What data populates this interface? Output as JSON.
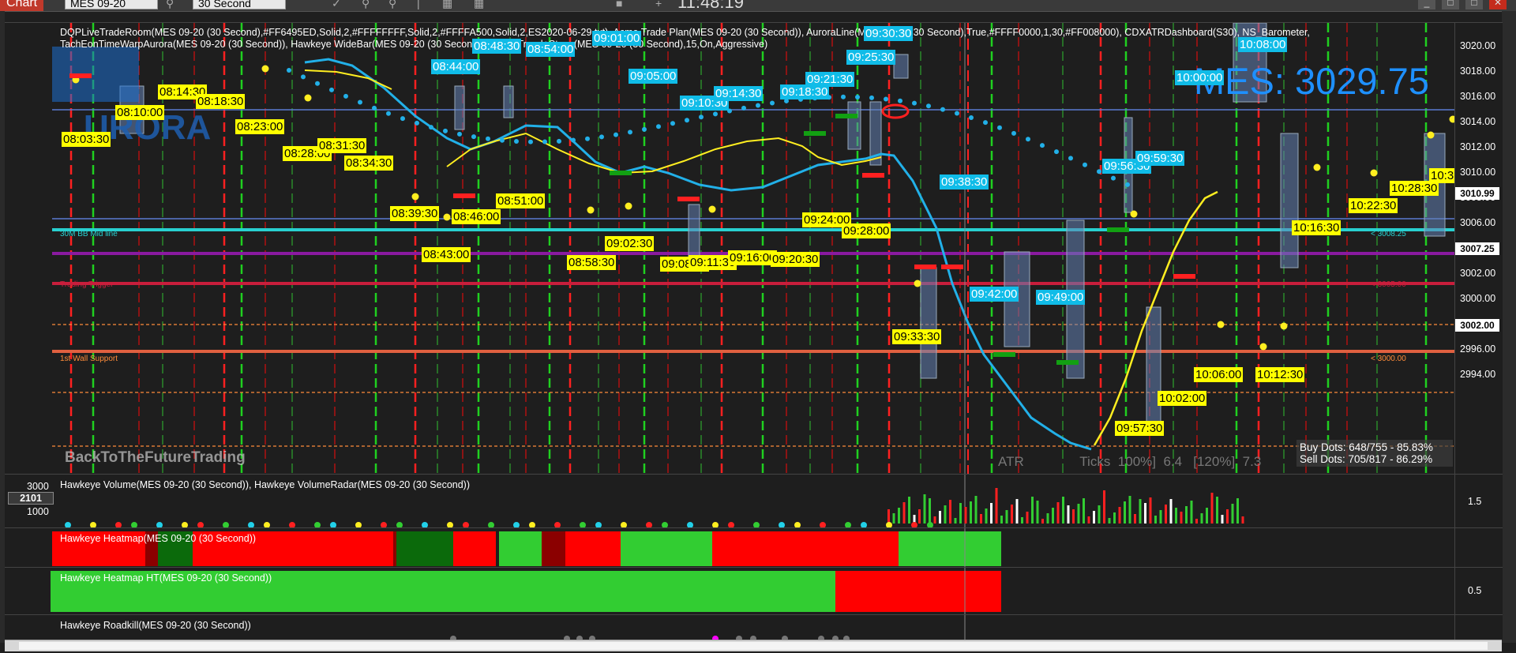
{
  "toolbar": {
    "chart_button": "Chart",
    "instrument": "MES 09-20",
    "interval": "30 Second",
    "clock": "11:48:19"
  },
  "main_panel": {
    "indicator_line_1": "DQPLiveTradeRoom(MES 09-20 (30 Second),#FF6495ED,Solid,2,#FFFFFFFF,Solid,2,#FFFFA500,Solid,2,ES2020-06-29.txt), Acme Trade Plan(MES 09-20 (30 Second)), AuroraLine(MES 09-20 (30 Second),True,#FFFF0000,1,30,#FF008000), CDXATRDashboard(S30), NS_Barometer,",
    "indicator_line_2": "TachEonTimeWarpAurora(MES 09-20 (30 Second)), Hawkeye WideBar(MES 09-20 (30 Second)), Wolfe Trend+Stops(MES 09-20 (30 Second),15,On,Aggressive)",
    "watermark_aurora": "URORA",
    "watermark_site": "BackToTheFutureTrading",
    "big_price": "MES: 3029.75",
    "buy_dots": "Buy Dots: 648/755 - 85.83%",
    "sell_dots": "Sell Dots: 705/817 - 86.29%",
    "atr_label": "ATR",
    "ticks_label": "Ticks",
    "pct100": "100%]",
    "pct100_val": "6.4",
    "pct120": "[120%]",
    "pct120_val": "7.3",
    "line_label_mid": "30M BB Mid line",
    "line_label_trigger": "Trading Trigger",
    "line_label_support": "1st Wall Support",
    "right_label_top": "< 3008.25",
    "right_label_mid": "< 3005.00",
    "right_label_low": "< 3000.00",
    "time_labels": [
      {
        "t": "08:44:00",
        "k": "c"
      },
      {
        "t": "08:48:30",
        "k": "c"
      },
      {
        "t": "08:54:00",
        "k": "c"
      },
      {
        "t": "09:01:00",
        "k": "c"
      },
      {
        "t": "09:05:00",
        "k": "c"
      },
      {
        "t": "09:10:30",
        "k": "c"
      },
      {
        "t": "09:14:30",
        "k": "c"
      },
      {
        "t": "09:18:30",
        "k": "c"
      },
      {
        "t": "09:21:30",
        "k": "c"
      },
      {
        "t": "09:25:30",
        "k": "c"
      },
      {
        "t": "09:30:30",
        "k": "c"
      },
      {
        "t": "09:38:30",
        "k": "c"
      },
      {
        "t": "09:42:00",
        "k": "c"
      },
      {
        "t": "09:49:00",
        "k": "c"
      },
      {
        "t": "09:56:30",
        "k": "c"
      },
      {
        "t": "09:59:30",
        "k": "c"
      },
      {
        "t": "10:00:00",
        "k": "c"
      },
      {
        "t": "10:08:00",
        "k": "c"
      },
      {
        "t": "08:14:30",
        "k": "y"
      },
      {
        "t": "08:18:30",
        "k": "y"
      },
      {
        "t": "08:10:00",
        "k": "y"
      },
      {
        "t": "08:03:30",
        "k": "y"
      },
      {
        "t": "08:23:00",
        "k": "y"
      },
      {
        "t": "08:28:00",
        "k": "y"
      },
      {
        "t": "08:31:30",
        "k": "y"
      },
      {
        "t": "08:34:30",
        "k": "y"
      },
      {
        "t": "08:39:30",
        "k": "y"
      },
      {
        "t": "08:46:00",
        "k": "y"
      },
      {
        "t": "08:51:00",
        "k": "y"
      },
      {
        "t": "08:43:00",
        "k": "y"
      },
      {
        "t": "08:58:30",
        "k": "y"
      },
      {
        "t": "09:02:30",
        "k": "y"
      },
      {
        "t": "09:08:00",
        "k": "y"
      },
      {
        "t": "09:11:30",
        "k": "y"
      },
      {
        "t": "09:16:00",
        "k": "y"
      },
      {
        "t": "09:20:30",
        "k": "y"
      },
      {
        "t": "09:24:00",
        "k": "y"
      },
      {
        "t": "09:28:00",
        "k": "y"
      },
      {
        "t": "09:33:30",
        "k": "y"
      },
      {
        "t": "09:57:30",
        "k": "y"
      },
      {
        "t": "10:02:00",
        "k": "y"
      },
      {
        "t": "10:06:00",
        "k": "y"
      },
      {
        "t": "10:12:30",
        "k": "y"
      },
      {
        "t": "10:16:30",
        "k": "y"
      },
      {
        "t": "10:22:30",
        "k": "y"
      },
      {
        "t": "10:28:30",
        "k": "y"
      },
      {
        "t": "10:3",
        "k": "y"
      }
    ]
  },
  "price_axis": {
    "ticks": [
      "3020.00",
      "3018.00",
      "3016.00",
      "3014.00",
      "3012.00",
      "3010.00",
      "3008.00",
      "3006.00",
      "3004.00",
      "3002.00",
      "3000.00",
      "2998.00",
      "2996.00",
      "2994.00"
    ],
    "box_top": "3010.99",
    "box_mid": "3007.25",
    "box_low": "3002.00"
  },
  "volume_panel": {
    "title": "Hawkeye Volume(MES 09-20 (30 Second)), Hawkeye VolumeRadar(MES 09-20 (30 Second))",
    "axis_top": "3000",
    "axis_current": "2101",
    "axis_low": "1000",
    "right_axis": "1.5"
  },
  "heatmap_panel": {
    "title": "Hawkeye Heatmap(MES 09-20 (30 Second))"
  },
  "heatmap_ht_panel": {
    "title": "Hawkeye Heatmap HT(MES 09-20 (30 Second))",
    "right_axis": "0.5"
  },
  "roadkill_panel": {
    "title": "Hawkeye Roadkill(MES 09-20 (30 Second))"
  },
  "colors": {
    "bg": "#1e1e1e",
    "heat_red": "#ff0000",
    "heat_green": "#32cd32",
    "heat_darkgreen": "#0b6a0b",
    "heat_darkred": "#8b0000",
    "cyan_label": "#10bce8",
    "yellow_label": "#ffff00",
    "accent_price": "#1e90ff"
  }
}
